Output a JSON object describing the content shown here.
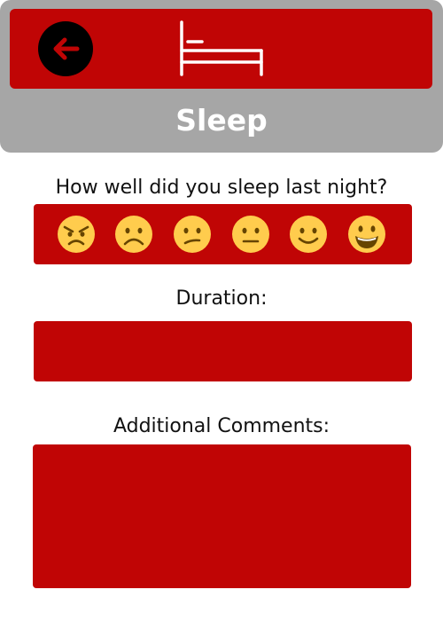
{
  "header": {
    "title": "Sleep",
    "back_icon": "back-arrow-icon",
    "logo_icon": "bed-icon"
  },
  "rating": {
    "question": "How well did you sleep last night?",
    "options": [
      {
        "icon": "angry-face-icon"
      },
      {
        "icon": "frowning-face-icon"
      },
      {
        "icon": "confused-face-icon"
      },
      {
        "icon": "neutral-face-icon"
      },
      {
        "icon": "slightly-smiling-face-icon"
      },
      {
        "icon": "grinning-face-icon"
      }
    ]
  },
  "duration": {
    "label": "Duration:",
    "value": "",
    "placeholder": ""
  },
  "comments": {
    "label": "Additional Comments:",
    "value": "",
    "placeholder": ""
  },
  "colors": {
    "accent_red": "#c00505",
    "header_gray": "#a6a6a6",
    "face_yellow": "#ffcc4d",
    "face_features": "#664500"
  }
}
